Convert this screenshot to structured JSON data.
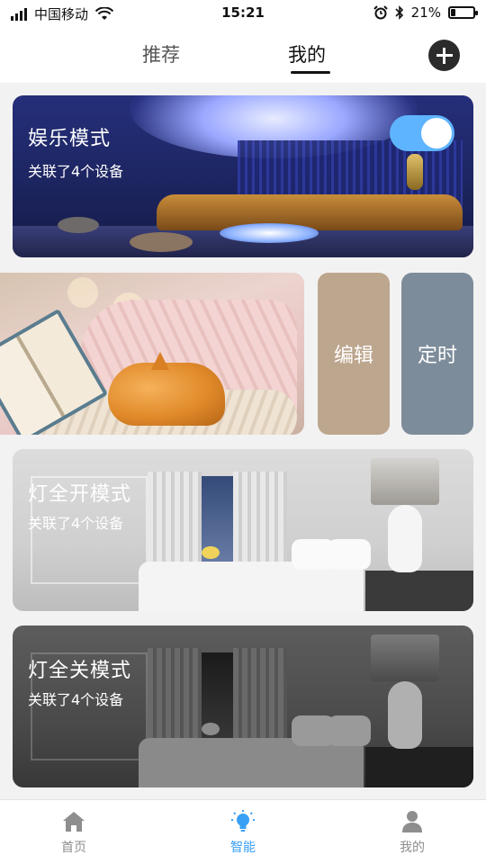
{
  "status_bar": {
    "carrier": "中国移动",
    "time": "15:21",
    "battery_text": "21%",
    "battery_level": 0.21
  },
  "header": {
    "tabs": [
      {
        "label": "推荐",
        "active": false
      },
      {
        "label": "我的",
        "active": true
      }
    ],
    "add_icon": "plus-circle-icon"
  },
  "scenes": [
    {
      "title": "娱乐模式",
      "subtitle": "关联了4个设备",
      "enabled": true,
      "toggle_color": "#5fb4ff"
    },
    {
      "title": "",
      "subtitle": "",
      "actions": [
        "编辑",
        "定时"
      ],
      "action_colors": [
        "#bda68e",
        "#7d8c9a"
      ]
    },
    {
      "title": "灯全开模式",
      "subtitle": "关联了4个设备"
    },
    {
      "title": "灯全关模式",
      "subtitle": "关联了4个设备"
    }
  ],
  "tabbar": {
    "items": [
      {
        "label": "首页",
        "icon": "home-icon",
        "active": false
      },
      {
        "label": "智能",
        "icon": "bulb-icon",
        "active": true
      },
      {
        "label": "我的",
        "icon": "user-icon",
        "active": false
      }
    ],
    "active_color": "#3aa0f5",
    "inactive_color": "#8e8e8e"
  }
}
